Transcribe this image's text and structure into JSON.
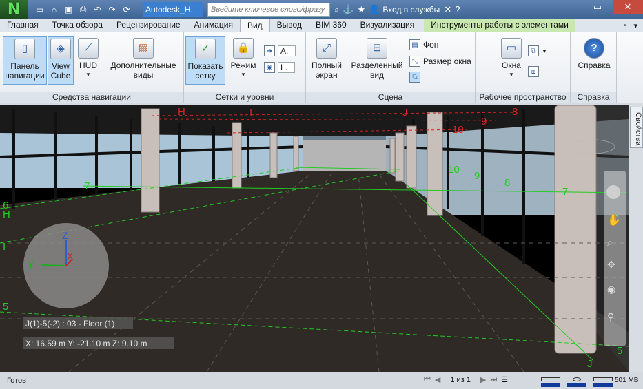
{
  "titlebar": {
    "app_letter": "N",
    "doc_title": "Autodesk_H...",
    "search_placeholder": "Введите ключевое слово/фразу",
    "login": "Вход в службы",
    "help": "?"
  },
  "tabs": [
    {
      "label": "Главная"
    },
    {
      "label": "Точка обзора"
    },
    {
      "label": "Рецензирование"
    },
    {
      "label": "Анимация"
    },
    {
      "label": "Вид",
      "active": true
    },
    {
      "label": "Вывод"
    },
    {
      "label": "BIM 360"
    },
    {
      "label": "Визуализация"
    },
    {
      "label": "Инструменты работы с элементами",
      "contextual": true
    }
  ],
  "ribbon": {
    "nav": {
      "title": "Средства навигации",
      "panel_btn": "Панель навигации",
      "viewcube_btn": "View Cube",
      "hud_btn": "HUD",
      "extra_btn": "Дополнительные виды"
    },
    "grids": {
      "title": "Сетки и уровни",
      "show_grid": "Показать сетку",
      "mode": "Режим",
      "combo1": "A.",
      "combo2": "L."
    },
    "scene": {
      "title": "Сцена",
      "fullscreen": "Полный экран",
      "split": "Разделенный вид",
      "background": "Фон",
      "window_size": "Размер окна"
    },
    "workspace": {
      "title": "Рабочее пространство",
      "windows": "Окна"
    },
    "help": {
      "title": "Справка",
      "label": "Справка"
    }
  },
  "viewport": {
    "location_label": "J(1)-5(-2) : 03 - Floor (1)",
    "coords": "X: 16.59 m  Y: -21.10 m  Z: 9.10 m",
    "gizmo": {
      "z": "Z",
      "y": "Y",
      "x": "X"
    },
    "grid_labels": [
      "H",
      "I",
      "J",
      "8",
      "9",
      "10",
      "7",
      "6",
      "5",
      "I",
      "J",
      "H",
      "9",
      "10",
      "8",
      "7",
      "6",
      "5"
    ]
  },
  "side_panel": {
    "label": "Свойства"
  },
  "status": {
    "text": "Готов",
    "page": "1 из 1",
    "memory": "501 MB"
  },
  "colors": {
    "grid_green": "#22cc22",
    "grid_red": "#cc2222",
    "titlebar": "#4a6f9f"
  }
}
